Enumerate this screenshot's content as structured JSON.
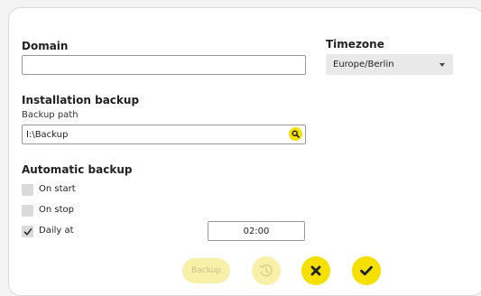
{
  "domain": {
    "title": "Domain",
    "value": ""
  },
  "timezone": {
    "title": "Timezone",
    "selected": "Europe/Berlin"
  },
  "installation_backup": {
    "title": "Installation backup",
    "path_label": "Backup path",
    "path_value": "I:\\Backup"
  },
  "automatic_backup": {
    "title": "Automatic backup",
    "on_start": {
      "label": "On start",
      "checked": false
    },
    "on_stop": {
      "label": "On stop",
      "checked": false
    },
    "daily": {
      "label": "Daily at",
      "checked": true,
      "time": "02:00"
    }
  },
  "actions": {
    "backup_label": "Backup"
  },
  "colors": {
    "accent": "#f5e000",
    "accent_disabled": "#f8f0a8"
  },
  "icons": {
    "search": "search-icon",
    "restore": "restore-icon",
    "cancel": "close-icon",
    "confirm": "check-icon",
    "dropdown": "chevron-down-icon"
  }
}
